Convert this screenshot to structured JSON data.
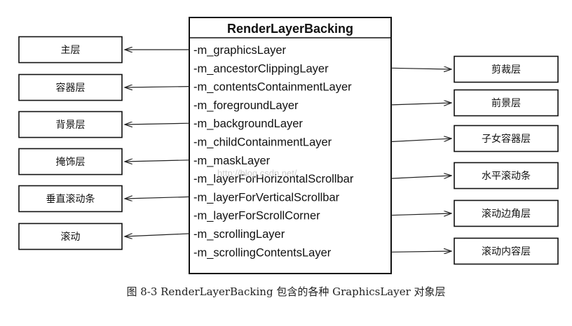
{
  "class": {
    "title": "RenderLayerBacking",
    "members": [
      "-m_graphicsLayer",
      "-m_ancestorClippingLayer",
      "-m_contentsContainmentLayer",
      "-m_foregroundLayer",
      "-m_backgroundLayer",
      "-m_childContainmentLayer",
      "-m_maskLayer",
      "-m_layerForHorizontalScrollbar",
      "-m_layerForVerticalScrollbar",
      "-m_layerForScrollCorner",
      "-m_scrollingLayer",
      "-m_scrollingContentsLayer"
    ]
  },
  "left_boxes": [
    {
      "label": "主层",
      "member_index": 0
    },
    {
      "label": "容器层",
      "member_index": 2
    },
    {
      "label": "背景层",
      "member_index": 4
    },
    {
      "label": "掩饰层",
      "member_index": 6
    },
    {
      "label": "垂直滚动条",
      "member_index": 8
    },
    {
      "label": "滚动",
      "member_index": 10
    }
  ],
  "right_boxes": [
    {
      "label": "剪裁层",
      "member_index": 1
    },
    {
      "label": "前景层",
      "member_index": 3
    },
    {
      "label": "子女容器层",
      "member_index": 5
    },
    {
      "label": "水平滚动条",
      "member_index": 7
    },
    {
      "label": "滚动边角层",
      "member_index": 9
    },
    {
      "label": "滚动内容层",
      "member_index": 11
    }
  ],
  "watermark": "http://blog.csdn.net/",
  "caption": "图 8-3    RenderLayerBacking 包含的各种 GraphicsLayer 对象层"
}
